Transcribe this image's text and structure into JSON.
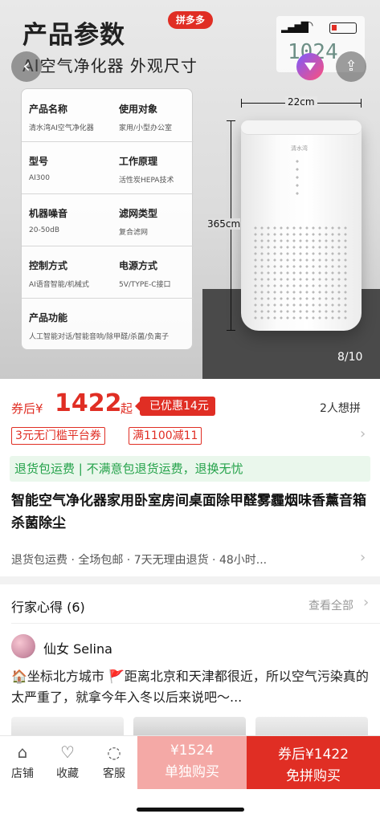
{
  "hero": {
    "title": "产品参数",
    "subtitle": "AI空气净化器  外观尺寸",
    "badge": "拼多多",
    "clock": "1024",
    "pager": "8/10",
    "dimension_width": "22cm",
    "dimension_height": "365cm",
    "brand_on_device": "清水湾",
    "specs": [
      {
        "label": "产品名称",
        "value": "清水湾AI空气净化器"
      },
      {
        "label": "使用对象",
        "value": "家用/小型办公室"
      },
      {
        "label": "型号",
        "value": "AI300"
      },
      {
        "label": "工作原理",
        "value": "活性炭HEPA技术"
      },
      {
        "label": "机器噪音",
        "value": "20-50dB"
      },
      {
        "label": "滤网类型",
        "value": "复合滤网"
      },
      {
        "label": "控制方式",
        "value": "AI语音智能/机械式"
      },
      {
        "label": "电源方式",
        "value": "5V/TYPE-C接口"
      },
      {
        "label": "产品功能",
        "value": "人工智能对话/智能音响/除甲醛/杀菌/负离子"
      }
    ]
  },
  "price": {
    "prefix": "券后¥",
    "value": "1422",
    "suffix": "起",
    "discount": "已优惠14元",
    "want_count": "2人想拼",
    "coupons": [
      "3元无门槛平台券",
      "满1100减11"
    ]
  },
  "service_strip": "退货包运费 | 不满意包退货运费，退换无忧",
  "product_title": "智能空气净化器家用卧室房间桌面除甲醛雾霾烟味香薰音箱杀菌除尘",
  "guarantee": "退货包运费 · 全场包邮 · 7天无理由退货 · 48小时...",
  "reviews": {
    "title": "行家心得 (6)",
    "see_all": "查看全部",
    "reviewer": "仙女 Selina",
    "text": "🏠坐标北方城市 🚩距离北京和天津都很近，所以空气污染真的太严重了，就拿今年入冬以后来说吧～..."
  },
  "bottom_bar": {
    "store": "店铺",
    "favorite": "收藏",
    "service": "客服",
    "alone_price": "¥1524",
    "alone_label": "单独购买",
    "group_price": "券后¥1422",
    "group_label": "免拼购买"
  }
}
